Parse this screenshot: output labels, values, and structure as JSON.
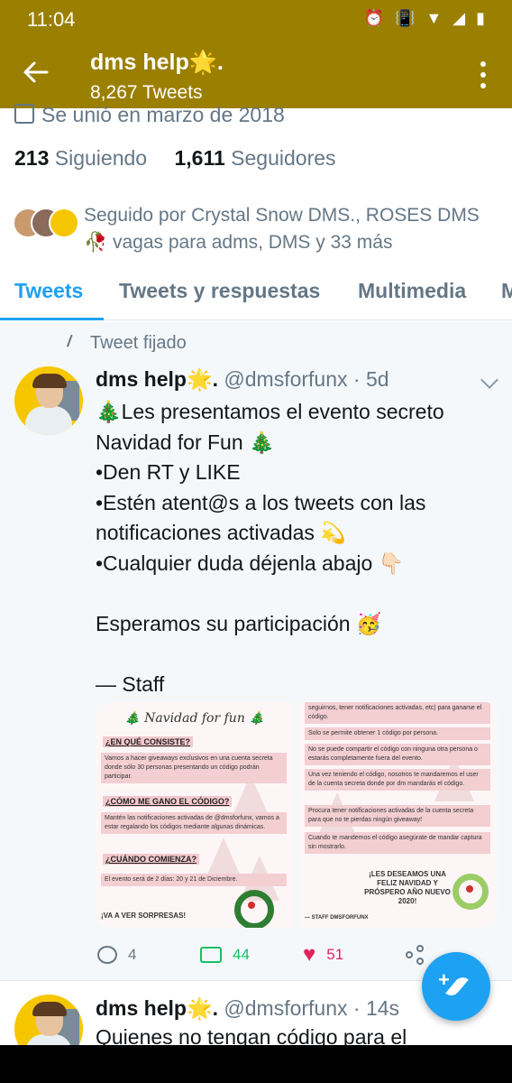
{
  "status_bar": {
    "time": "11:04"
  },
  "app_bar": {
    "title": "dms help🌟.",
    "subtitle": "8,267 Tweets"
  },
  "profile": {
    "joined": "Se unió en marzo de 2018",
    "following_count": "213",
    "following_label": "Siguiendo",
    "followers_count": "1,611",
    "followers_label": "Seguidores",
    "followed_by": "Seguido por Crystal Snow DMS., ROSES DMS 🥀 vagas para adms, DMS y 33 más"
  },
  "tabs": [
    {
      "label": "Tweets"
    },
    {
      "label": "Tweets y respuestas"
    },
    {
      "label": "Multimedia"
    },
    {
      "label": "M"
    }
  ],
  "pinned_tweet": {
    "pinned_label": "Tweet fijado",
    "author_name": "dms help🌟.",
    "meta": "@dmsforfunx · 5d",
    "lines": [
      "🎄Les presentamos el evento secreto",
      "Navidad for Fun 🎄",
      "•Den RT y LIKE",
      "•Estén atent@s a los tweets con las",
      "notificaciones activadas 💫",
      "•Cualquier duda déjenla abajo 👇🏻",
      "",
      "Esperamos su participación 🥳",
      "",
      "— Staff"
    ],
    "image_left": {
      "title": "🎄 Navidad for fun 🎄",
      "h1": "¿EN QUÉ CONSISTE?",
      "b1": "Vamos a hacer giveaways exclusivos en una cuenta secreta donde sólo 30 personas presentando un código podrán participar.",
      "h2": "¿CÓMO ME GANO EL CÓDIGO?",
      "b2": "Mantén las notificaciones activadas de @dmsforfunx, vamos a estar regalando los códigos mediante algunas dinámicas.",
      "h3": "¿CUÁNDO COMIENZA?",
      "b3": "El evento será de 2 días: 20 y 21 de Diciembre.",
      "foot": "¡VA A VER SORPRESAS!"
    },
    "image_right": {
      "b0": "seguirnos, tener notificaciones activadas, etc) para ganarse el código.",
      "b1": "Solo se permite obtener 1 código por persona.",
      "b2": "No se puede compartir el código con ninguna otra persona o estarás completamente fuera del evento.",
      "b3": "Una vez teniendo el código, nosotros te mandaremos el user de la cuenta secreta donde por dm mandarás el código.",
      "b4": "Procura tener notificaciones activadas de la cuenta secreta para que no te pierdas ningún giveaway!",
      "b5": "Cuando te mandemos el código asegúrate de mandar captura sin mostrarlo.",
      "greeting": "¡LES DESEAMOS UNA FELIZ NAVIDAD Y PRÓSPERO AÑO NUEVO 2020!",
      "signature": "— STAFF DMSFORFUNX"
    },
    "replies": "4",
    "retweets": "44",
    "likes": "51"
  },
  "next_tweet": {
    "author_name": "dms help🌟.",
    "meta": "@dmsforfunx · 14s",
    "text": "Quienes no tengan código para el"
  },
  "colors": {
    "app_bar": "#9a7f00",
    "accent": "#1da1f2",
    "retweet": "#17bf63",
    "like": "#e0245e",
    "muted": "#657786"
  }
}
